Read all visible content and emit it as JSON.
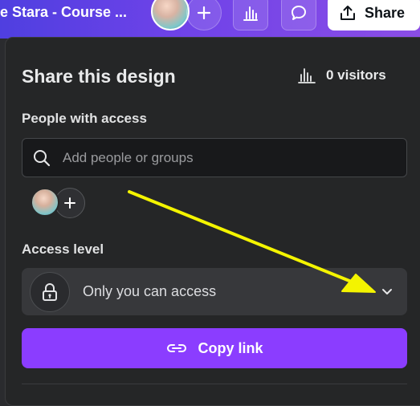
{
  "topbar": {
    "doc_title": "e Stara - Course ...",
    "share_label": "Share"
  },
  "panel": {
    "title": "Share this design",
    "visitors": "0 visitors",
    "people_label": "People with access",
    "search_placeholder": "Add people or groups",
    "access_label": "Access level",
    "access_value": "Only you can access",
    "copy_label": "Copy link"
  },
  "colors": {
    "accent": "#8b3dff",
    "annotation": "#f4f400",
    "panel_bg": "#252627"
  }
}
